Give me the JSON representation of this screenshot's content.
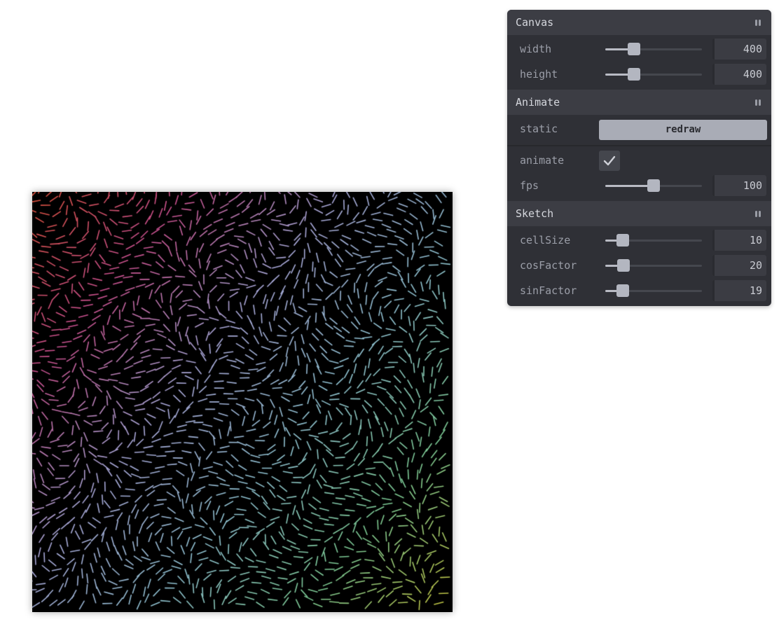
{
  "sketch": {
    "background": "#000000",
    "palette": [
      "#d9503a",
      "#c8508e",
      "#a7a6d6",
      "#8fc0d0",
      "#7cc994",
      "#c9c43a"
    ]
  },
  "panel": {
    "canvas_folder": {
      "title": "Canvas",
      "width": {
        "label": "width",
        "value": "400",
        "fraction": 0.3
      },
      "height": {
        "label": "height",
        "value": "400",
        "fraction": 0.3
      }
    },
    "animate_folder": {
      "title": "Animate",
      "static": {
        "label": "static",
        "button_label": "redraw"
      },
      "animate": {
        "label": "animate",
        "checked": true
      },
      "fps": {
        "label": "fps",
        "value": "100",
        "fraction": 0.5
      }
    },
    "sketch_folder": {
      "title": "Sketch",
      "cellSize": {
        "label": "cellSize",
        "value": "10",
        "fraction": 0.18
      },
      "cosFactor": {
        "label": "cosFactor",
        "value": "20",
        "fraction": 0.19
      },
      "sinFactor": {
        "label": "sinFactor",
        "value": "19",
        "fraction": 0.18
      }
    }
  }
}
